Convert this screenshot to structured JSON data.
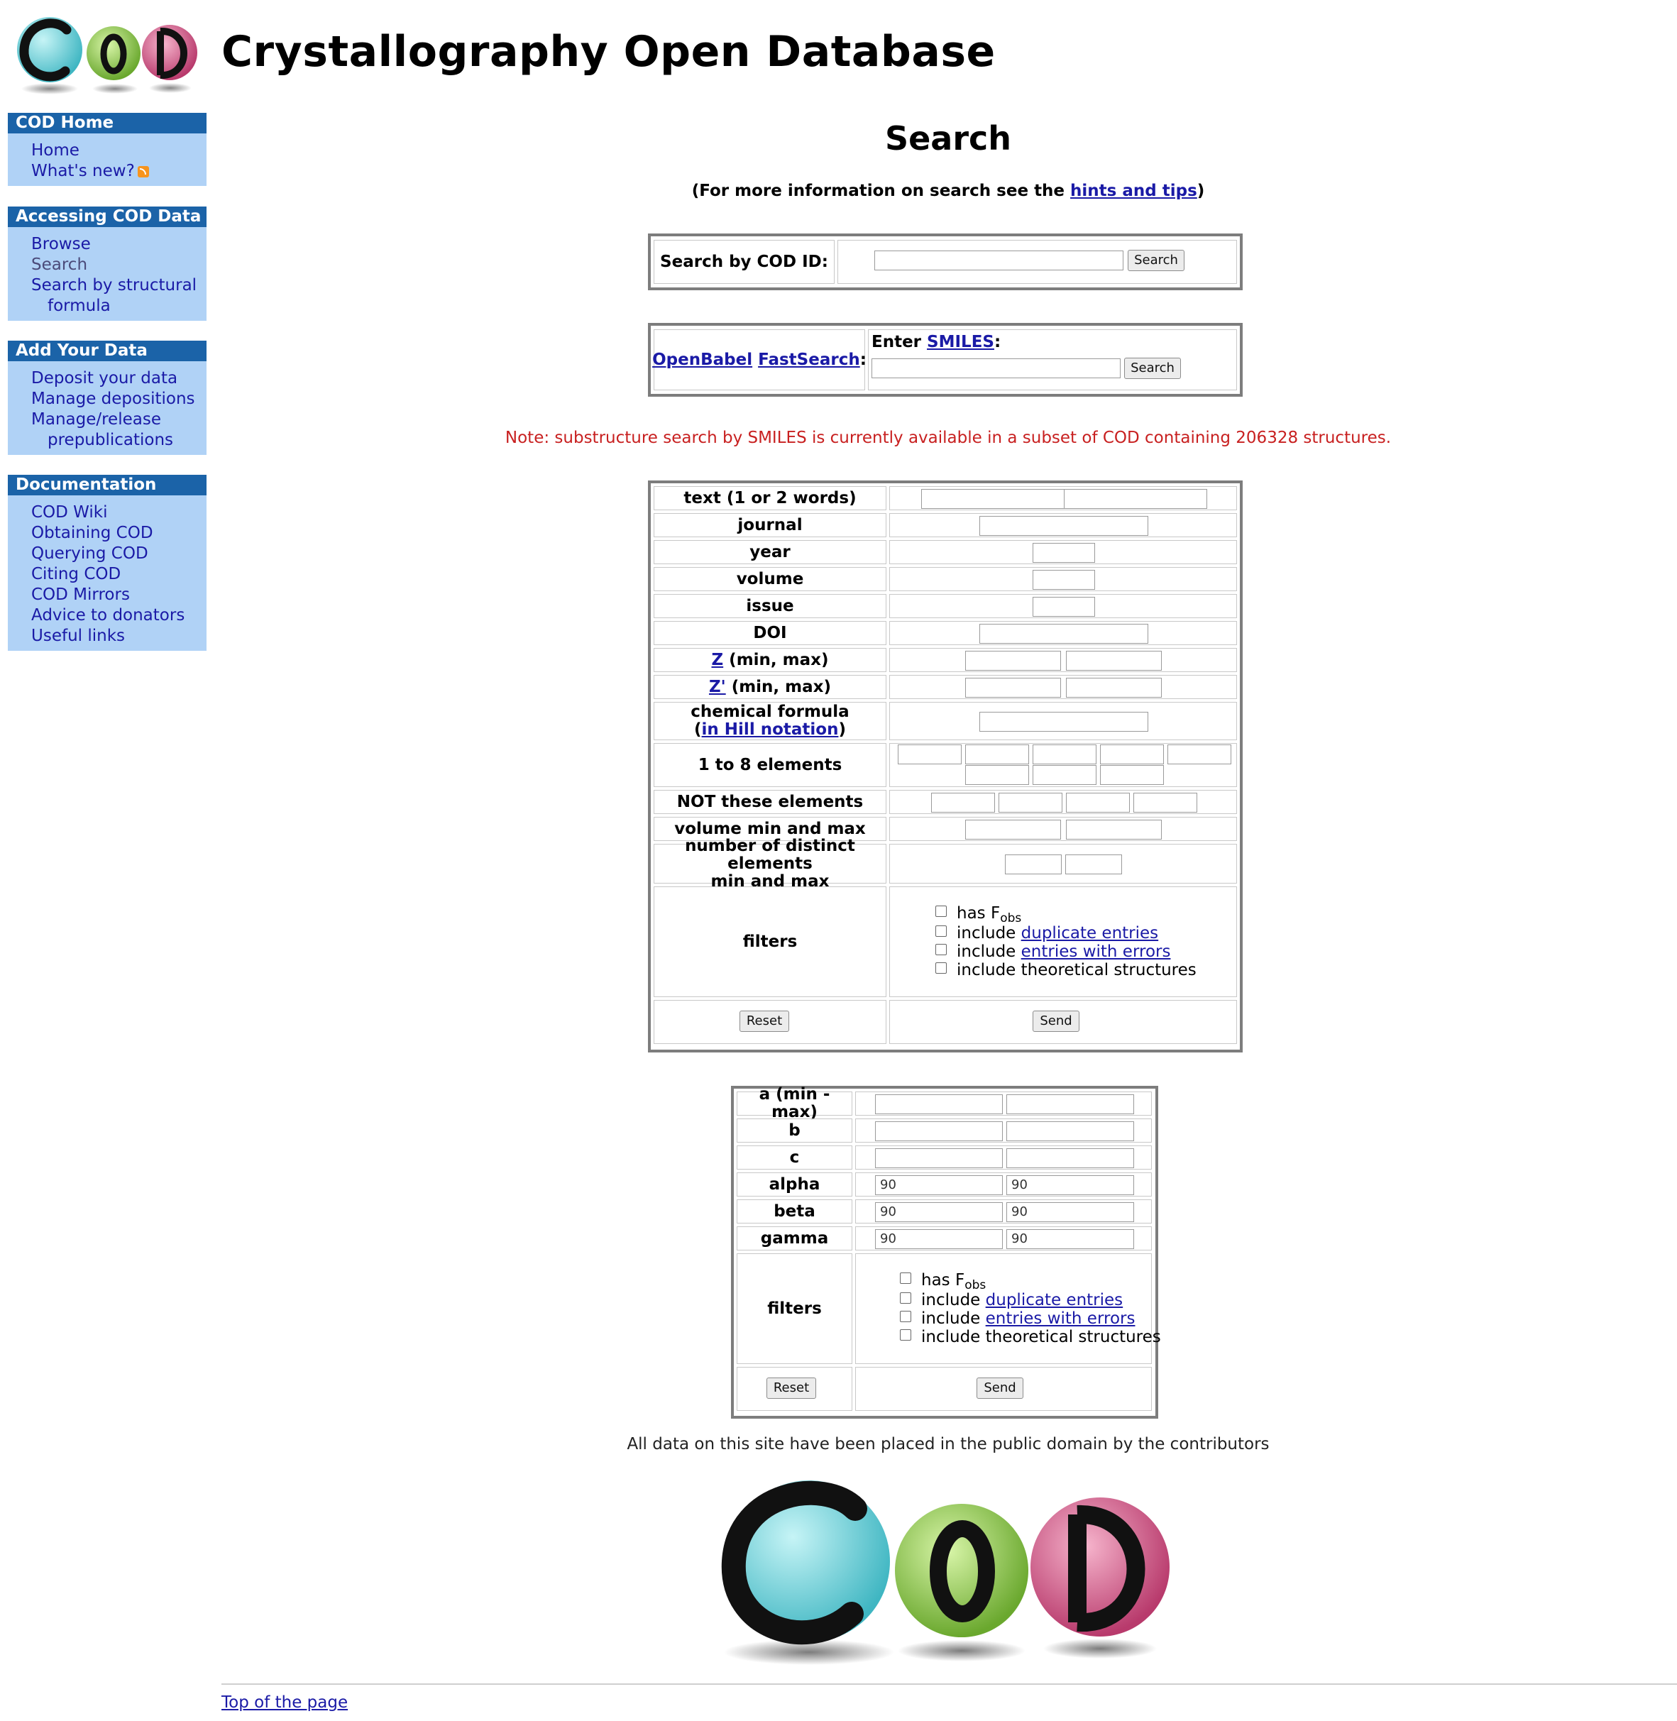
{
  "header": {
    "title": "Crystallography Open Database"
  },
  "sidebar": {
    "sections": [
      {
        "title": "COD Home",
        "items": [
          {
            "label": "Home"
          },
          {
            "label": "What's new?"
          }
        ]
      },
      {
        "title": "Accessing COD Data",
        "items": [
          {
            "label": "Browse"
          },
          {
            "label": "Search"
          },
          {
            "label": "Search by structural"
          },
          {
            "label": "formula"
          }
        ]
      },
      {
        "title": "Add Your Data",
        "items": [
          {
            "label": "Deposit your data"
          },
          {
            "label": "Manage depositions"
          },
          {
            "label": "Manage/release"
          },
          {
            "label": "prepublications"
          }
        ]
      },
      {
        "title": "Documentation",
        "items": [
          {
            "label": "COD Wiki"
          },
          {
            "label": "Obtaining COD"
          },
          {
            "label": "Querying COD"
          },
          {
            "label": "Citing COD"
          },
          {
            "label": "COD Mirrors"
          },
          {
            "label": "Advice to donators"
          },
          {
            "label": "Useful links"
          }
        ]
      }
    ]
  },
  "main": {
    "title": "Search",
    "hint_prefix": "(For more information on search see the ",
    "hint_link": "hints and tips",
    "hint_suffix": ")",
    "cod_id": {
      "label": "Search by COD ID:",
      "button": "Search"
    },
    "smiles": {
      "link1": "OpenBabel",
      "link2": "FastSearch",
      "colon": ":",
      "enter": "Enter ",
      "smiles_link": "SMILES",
      "smiles_colon": ":",
      "button": "Search"
    },
    "note": "Note: substructure search by SMILES is currently available in a subset of COD containing 206328 structures.",
    "form1": {
      "rows": {
        "text": "text (1 or 2 words)",
        "journal": "journal",
        "year": "year",
        "volume": "volume",
        "issue": "issue",
        "doi": "DOI",
        "z_link": "Z",
        "z_rest": " (min, max)",
        "zp_link": "Z'",
        "zp_rest": " (min, max)",
        "chem1": "chemical formula",
        "chem_open": "(",
        "chem_link": "in Hill notation",
        "chem_close": ")",
        "elements": "1 to 8 elements",
        "not_elements": "NOT these elements",
        "vol_minmax": "volume min and max",
        "distinct1": "number of distinct elements",
        "distinct2": "min and max",
        "filters": "filters"
      },
      "filters": {
        "fobs_prefix": "has F",
        "fobs_sub": "obs",
        "dup_prefix": "include ",
        "dup_link": "duplicate entries",
        "err_prefix": "include ",
        "err_link": "entries with errors",
        "theo": "include theoretical structures"
      },
      "reset": "Reset",
      "send": "Send"
    },
    "form2": {
      "rows": {
        "a": "a (min - max)",
        "b": "b",
        "c": "c",
        "alpha": "alpha",
        "beta": "beta",
        "gamma": "gamma",
        "filters": "filters"
      },
      "values": {
        "alpha_min": "90",
        "alpha_max": "90",
        "beta_min": "90",
        "beta_max": "90",
        "gamma_min": "90",
        "gamma_max": "90"
      },
      "filters": {
        "fobs_prefix": "has F",
        "fobs_sub": "obs",
        "dup_prefix": "include ",
        "dup_link": "duplicate entries",
        "err_prefix": "include ",
        "err_link": "entries with errors",
        "theo": "include theoretical structures"
      },
      "reset": "Reset",
      "send": "Send"
    },
    "footer_text": "All data on this site have been placed in the public domain by the contributors",
    "top_link": "Top of the page"
  },
  "colors": {
    "nav_head": "#1b63a8",
    "nav_bg": "#b0d2f6",
    "link": "#1a1aa6",
    "note": "#c82020",
    "logo_c": "#5fd3da",
    "logo_o": "#8fd14f",
    "logo_d": "#dc5a8c"
  }
}
